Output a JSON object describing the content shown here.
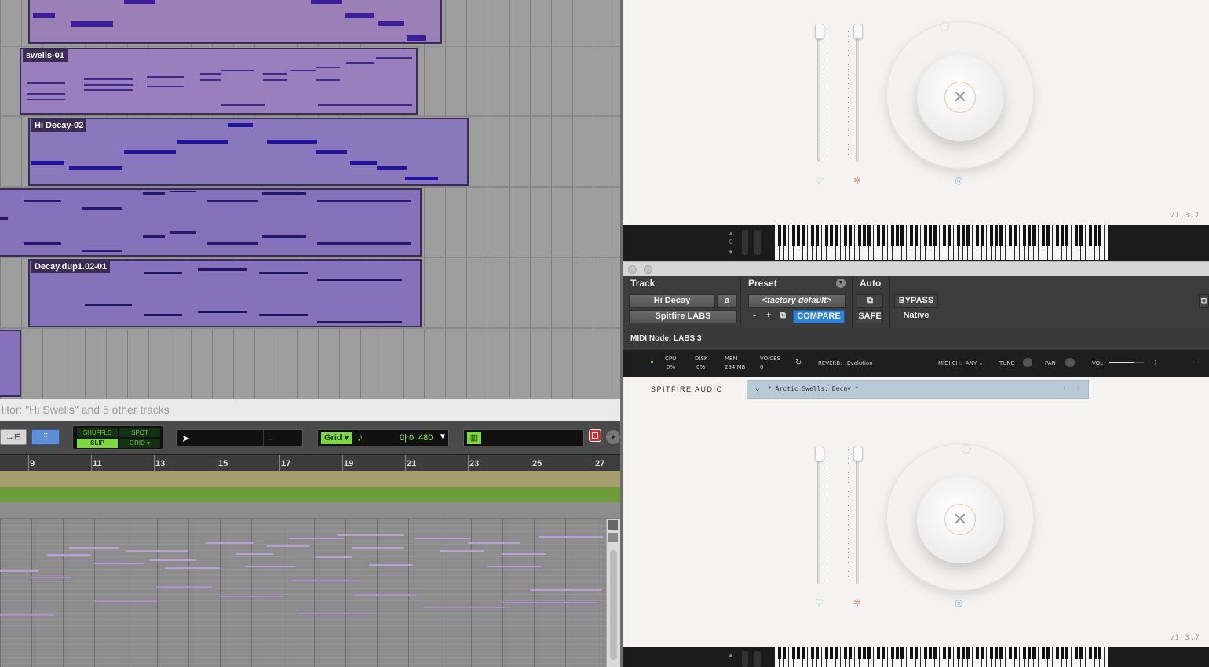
{
  "arrange": {
    "clips": [
      {
        "title": "",
        "color": "#9a80b6"
      },
      {
        "title": "swells-01",
        "color": "#9a7fbf"
      },
      {
        "title": "Hi Decay-02",
        "color": "#8a78bd"
      },
      {
        "title": "",
        "color": "#8672bb"
      },
      {
        "title": "Decay.dup1.02-01",
        "color": "#8672bb"
      },
      {
        "title": "",
        "color": "#8672bb"
      }
    ]
  },
  "editor": {
    "title": "litor: \"Hi Swells\" and 5 other tracks",
    "modes": {
      "shuffle": "SHUFFLE",
      "spot": "SPOT",
      "slip": "SLIP",
      "grid": "GRID"
    },
    "grid_label": "Grid",
    "grid_value": "0| 0| 480",
    "counter_value": "_",
    "ruler_numbers": [
      "9",
      "11",
      "13",
      "15",
      "17",
      "19",
      "21",
      "23",
      "25",
      "27"
    ]
  },
  "plugin": {
    "version": "v1.3.7",
    "track_label": "Track",
    "preset_label": "Preset",
    "auto_label": "Auto",
    "track_name": "Hi Decay",
    "track_suffix": "a",
    "plugin_name": "Spitfire LABS",
    "factory_default": "<factory default>",
    "minus": "-",
    "plus": "+",
    "compare": "COMPARE",
    "bypass": "BYPASS",
    "safe": "SAFE",
    "native": "Native",
    "midi_node": "MIDI Node: LABS 3",
    "status": {
      "cpu_label": "CPU",
      "cpu_value": "0%",
      "disk_label": "DISK",
      "disk_value": "0%",
      "mem_label": "MEM",
      "mem_value": "294 MB",
      "voices_label": "VOICES",
      "voices_value": "0",
      "reverb_label": "REVERB:",
      "reverb_value": "Evolution",
      "midi_ch_label": "MIDI CH:",
      "midi_ch_value": "ANY",
      "tune_label": "TUNE",
      "pan_label": "PAN",
      "vol_label": "VOL",
      "more": "..."
    },
    "brand": "SPITFIRE AUDIO",
    "preset_name": "* Arctic Swells: Decay *",
    "kbd_octave": "0"
  },
  "colors": {
    "note_dark": "#2a1f9e",
    "note_light": "#c3a7e6",
    "compare": "#2e83d8",
    "green": "#6e9b3c"
  }
}
